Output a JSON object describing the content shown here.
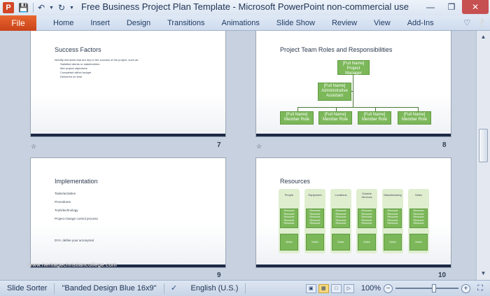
{
  "titlebar": {
    "app_icon": "P",
    "title": "Free Business Project Plan Template  -  Microsoft PowerPoint non-commercial use"
  },
  "ribbon": {
    "file_tab": "File",
    "tabs": [
      "Home",
      "Insert",
      "Design",
      "Transitions",
      "Animations",
      "Slide Show",
      "Review",
      "View",
      "Add-Ins"
    ]
  },
  "slides": {
    "s7": {
      "title": "Success Factors",
      "bullets": [
        "Identify elements that are key to the success of the project, such as:",
        "Satisfied clients or stakeholders",
        "Met project objectives",
        "Completed within budget",
        "Delivered on time"
      ],
      "number": "7"
    },
    "s8": {
      "title": "Project Team Roles and Responsibilities",
      "manager": [
        "[Full Name]",
        "Project Manager"
      ],
      "assistant": [
        "[Full Name]",
        "Administrative",
        "Assistant"
      ],
      "member_name": "[Full Name]",
      "member_role": "Member Role",
      "number": "8"
    },
    "s9": {
      "title": "Implementation",
      "bullets": [
        "Tasks/activities",
        "Procedures",
        "Tools/technology",
        "Project change control process"
      ],
      "footnote": "DYA: define your acronymal",
      "number": "9"
    },
    "s10": {
      "title": "Resources",
      "columns": [
        "People",
        "Equipment",
        "Locations",
        "Outside Services",
        "Manufacturing",
        "Sales"
      ],
      "resource_label": "Resource",
      "notes_label": "Notes",
      "number": "10"
    }
  },
  "watermark": "www.heritagechristiancollege.com",
  "statusbar": {
    "view": "Slide Sorter",
    "theme": "\"Banded Design Blue 16x9\"",
    "language": "English (U.S.)",
    "zoom": "100%",
    "zoom_level": 0.62
  },
  "colors": {
    "accent_green": "#7cb85a",
    "band_navy": "#1d2a46",
    "file_orange": "#d24726"
  }
}
